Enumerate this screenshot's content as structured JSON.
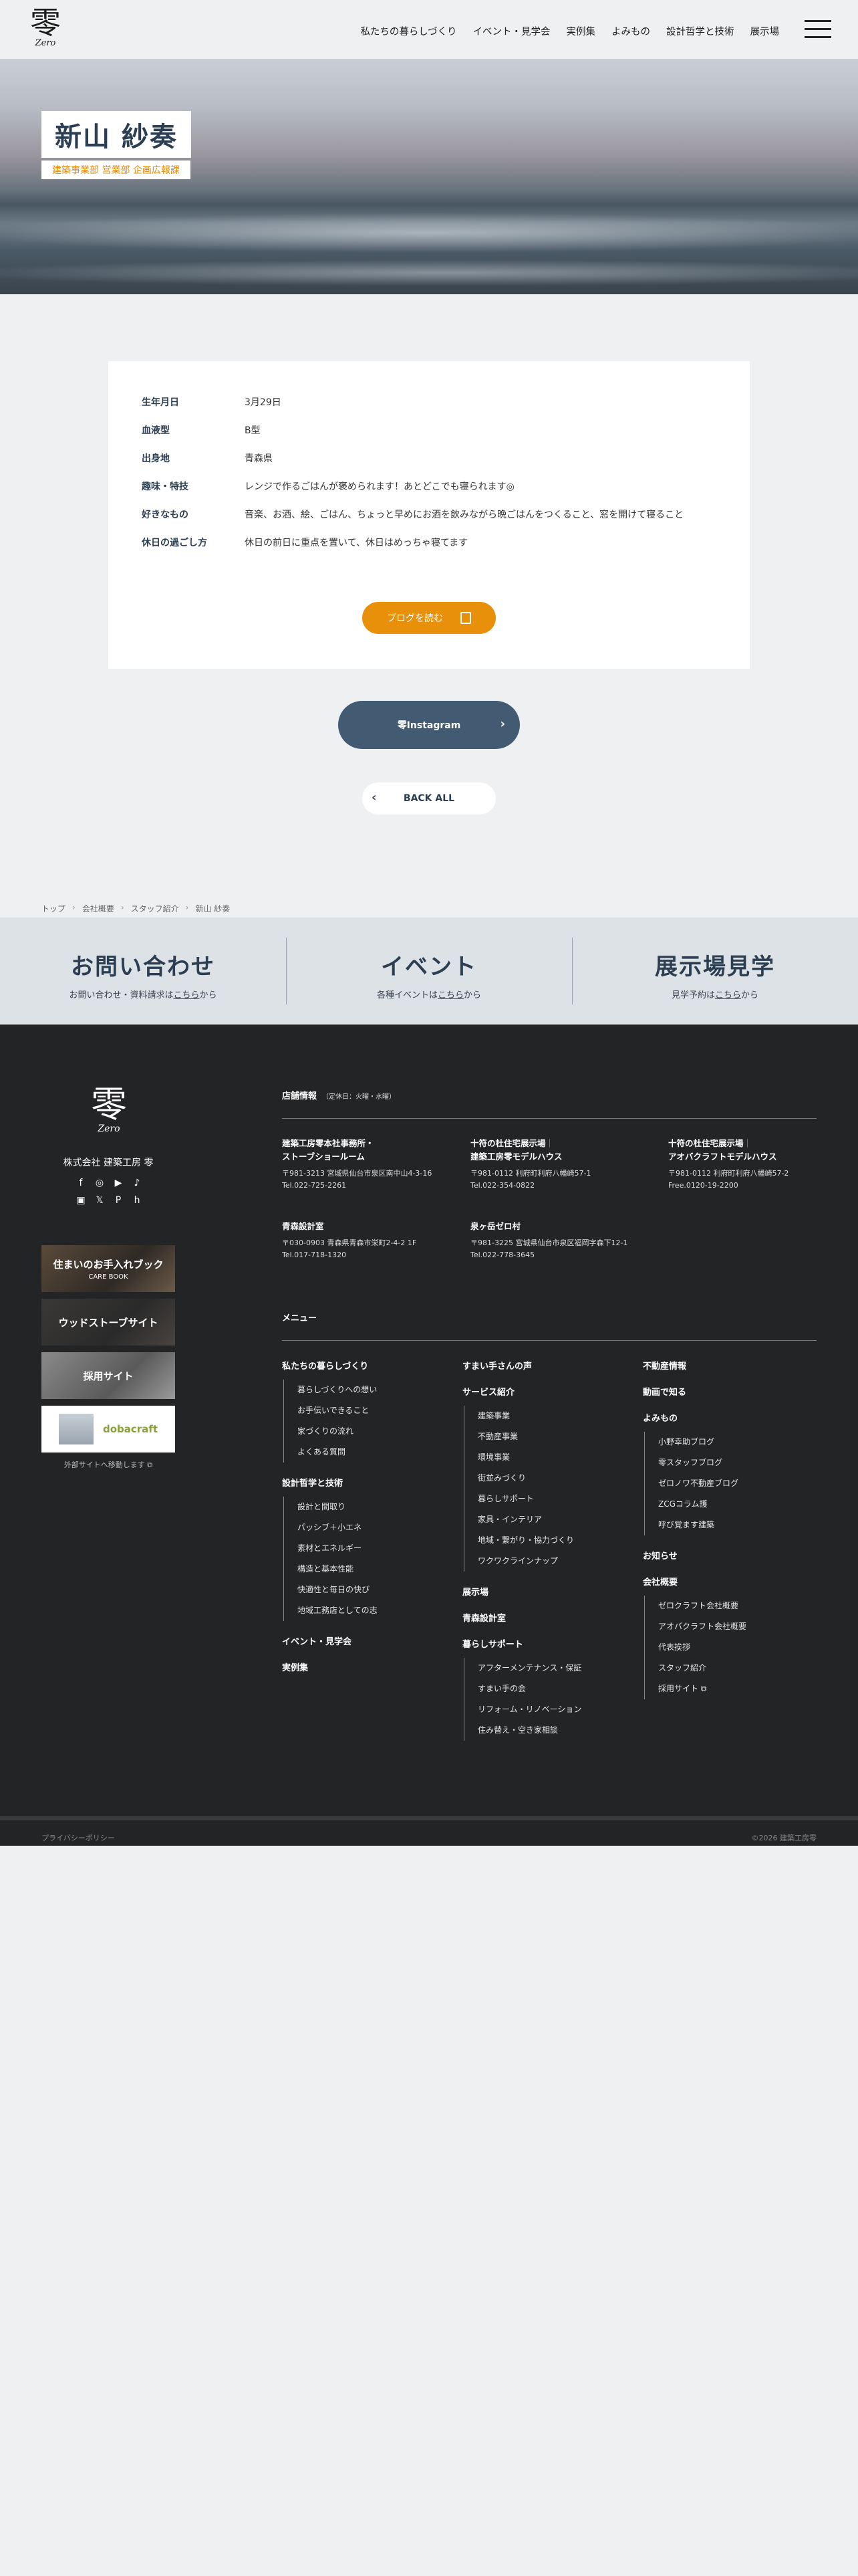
{
  "header": {
    "logo_kanji": "零",
    "logo_latin": "Zero",
    "nav": [
      "私たちの暮らしづくり",
      "イベント・見学会",
      "実例集",
      "よみもの",
      "設計哲学と技術",
      "展示場"
    ]
  },
  "hero": {
    "name": "新山 紗奏",
    "department": "建築事業部 営業部 企画広報課"
  },
  "profile": {
    "rows": [
      {
        "label": "生年月日",
        "value": "3月29日"
      },
      {
        "label": "血液型",
        "value": "B型"
      },
      {
        "label": "出身地",
        "value": "青森県"
      },
      {
        "label": "趣味・特技",
        "value": "レンジで作るごはんが褒められます！あとどこでも寝られます◎"
      },
      {
        "label": "好きなもの",
        "value": "音楽、お酒、絵、ごはん、ちょっと早めにお酒を飲みながら晩ごはんをつくること、窓を開けて寝ること"
      },
      {
        "label": "休日の過ごし方",
        "value": "休日の前日に重点を置いて、休日はめっちゃ寝てます"
      }
    ],
    "blog_button": "ブログを読む"
  },
  "buttons": {
    "instagram": "零Instagram",
    "back_all": "BACK ALL"
  },
  "breadcrumb": [
    "トップ",
    "会社概要",
    "スタッフ紹介",
    "新山 紗奏"
  ],
  "cta": [
    {
      "title": "お問い合わせ",
      "sub_pre": "お問い合わせ・資料請求は",
      "sub_link": "こちら",
      "sub_post": "から"
    },
    {
      "title": "イベント",
      "sub_pre": "各種イベントは",
      "sub_link": "こちら",
      "sub_post": "から"
    },
    {
      "title": "展示場見学",
      "sub_pre": "見学予約は",
      "sub_link": "こちら",
      "sub_post": "から"
    }
  ],
  "footer": {
    "logo_kanji": "零",
    "logo_latin": "Zero",
    "company": "株式会社 建築工房 零",
    "banners": [
      {
        "title": "住まいのお手入れブック",
        "sub": "CARE BOOK"
      },
      {
        "title": "ウッドストーブサイト",
        "sub": ""
      },
      {
        "title": "採用サイト",
        "sub": ""
      },
      {
        "title": "dobacraft",
        "sub": ""
      }
    ],
    "external_note": "外部サイトへ移動します ⧉",
    "shops_title": "店舗情報",
    "shops_note": "（定休日：火曜・水曜）",
    "shops": [
      {
        "name1": "建築工房零本社事務所・",
        "name2": "ストーブショールーム",
        "addr": "〒981-3213 宮城県仙台市泉区南中山4-3-16",
        "tel": "Tel.022-725-2261"
      },
      {
        "name1": "十符の杜住宅展示場",
        "name2": "建築工房零モデルハウス",
        "addr": "〒981-0112 利府町利府八幡崎57-1",
        "tel": "Tel.022-354-0822"
      },
      {
        "name1": "十符の杜住宅展示場",
        "name2": "アオバクラフトモデルハウス",
        "addr": "〒981-0112 利府町利府八幡崎57-2",
        "tel": "Free.0120-19-2200"
      },
      {
        "name1": "青森設計室",
        "name2": "",
        "addr": "〒030-0903 青森県青森市栄町2-4-2 1F",
        "tel": "Tel.017-718-1320"
      },
      {
        "name1": "泉ヶ岳ゼロ村",
        "name2": "",
        "addr": "〒981-3225 宮城県仙台市泉区福岡字森下12-1",
        "tel": "Tel.022-778-3645"
      }
    ],
    "menu_title": "メニュー",
    "menu_col1": [
      {
        "h": "私たちの暮らしづくり",
        "items": [
          "暮らしづくりへの想い",
          "お手伝いできること",
          "家づくりの流れ",
          "よくある質問"
        ]
      },
      {
        "h": "設計哲学と技術",
        "items": [
          "設計と間取り",
          "パッシブ＋小エネ",
          "素材とエネルギー",
          "構造と基本性能",
          "快適性と毎日の快び",
          "地域工務店としての志"
        ]
      },
      {
        "h": "イベント・見学会",
        "items": []
      },
      {
        "h": "実例集",
        "items": []
      }
    ],
    "menu_col2": [
      {
        "h": "すまい手さんの声",
        "items": []
      },
      {
        "h": "サービス紹介",
        "items": [
          "建築事業",
          "不動産事業",
          "環境事業",
          "街並みづくり",
          "暮らしサポート",
          "家具・インテリア",
          "地域・繋がり・協力づくり",
          "ワクワクラインナップ"
        ]
      },
      {
        "h": "展示場",
        "items": []
      },
      {
        "h": "青森設計室",
        "items": []
      },
      {
        "h": "暮らしサポート",
        "items": [
          "アフターメンテナンス・保証",
          "すまい手の会",
          "リフォーム・リノベーション",
          "住み替え・空き家相談"
        ]
      }
    ],
    "menu_col3": [
      {
        "h": "不動産情報",
        "items": []
      },
      {
        "h": "動画で知る",
        "items": []
      },
      {
        "h": "よみもの",
        "items": [
          "小野幸助ブログ",
          "零スタッフブログ",
          "ゼロノワ不動産ブログ",
          "ZCGコラム護",
          "呼び覚ます建築"
        ]
      },
      {
        "h": "お知らせ",
        "items": []
      },
      {
        "h": "会社概要",
        "items": [
          "ゼロクラフト会社概要",
          "アオバクラフト会社概要",
          "代表挨拶",
          "スタッフ紹介",
          "採用サイト ⧉"
        ]
      }
    ],
    "privacy": "プライバシーポリシー",
    "copyright": "©2026 建築工房零"
  }
}
